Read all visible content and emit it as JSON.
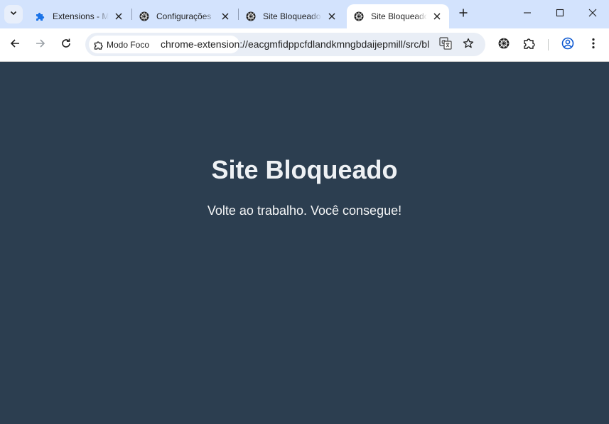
{
  "tabs": [
    {
      "title": "Extensions - Modo Foco",
      "icon": "puzzle-icon"
    },
    {
      "title": "Configurações",
      "icon": "extension-favicon"
    },
    {
      "title": "Site Bloqueado",
      "icon": "extension-favicon"
    },
    {
      "title": "Site Bloqueado",
      "icon": "extension-favicon",
      "active": true
    }
  ],
  "toolbar": {
    "chip_label": "Modo Foco",
    "url": "chrome-extension://eacgmfidppcfdlandkmngbdaijepmill/src/blocked.html"
  },
  "page": {
    "heading": "Site Bloqueado",
    "message": "Volte ao trabalho. Você consegue!"
  },
  "colors": {
    "background": "#2c3e50",
    "tabstrip": "#d3e3fd",
    "accent": "#0b57d0"
  }
}
